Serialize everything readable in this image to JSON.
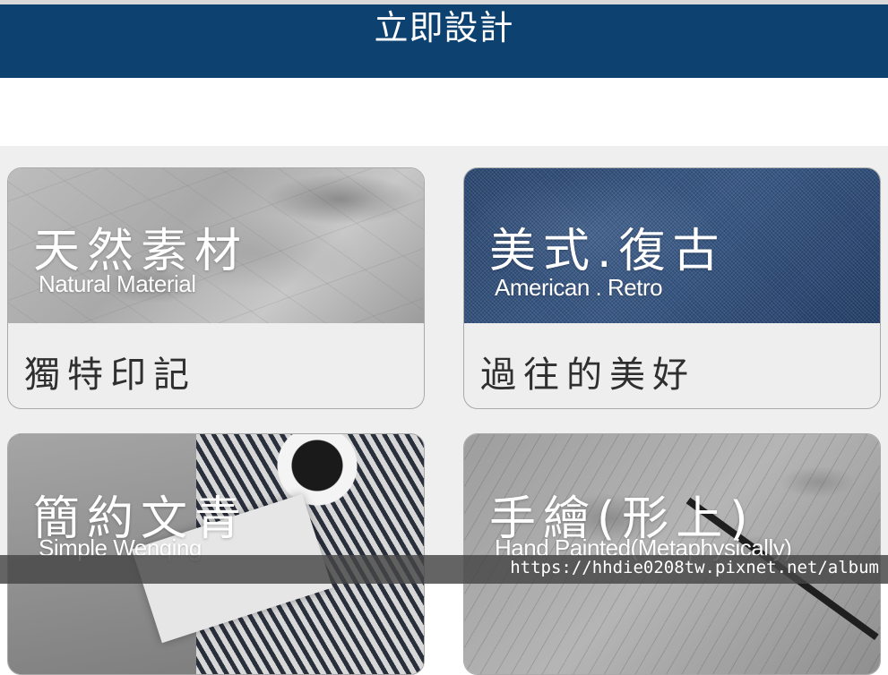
{
  "header": {
    "title": "立即設計"
  },
  "cards": [
    {
      "title_zh": "天然素材",
      "title_en": "Natural Material",
      "subtitle": "獨特印記"
    },
    {
      "title_zh": "美式.復古",
      "title_en": "American . Retro",
      "subtitle": "過往的美好"
    },
    {
      "title_zh": "簡約文青",
      "title_en": "Simple Wenqing",
      "subtitle": ""
    },
    {
      "title_zh": "手繪(形上)",
      "title_en": "Hand Painted(Metaphysically)",
      "subtitle": ""
    }
  ],
  "watermark": {
    "text": "https://hhdie0208tw.pixnet.net/album"
  },
  "colors": {
    "header_bg": "#0c4170",
    "grid_bg": "#efefef"
  }
}
